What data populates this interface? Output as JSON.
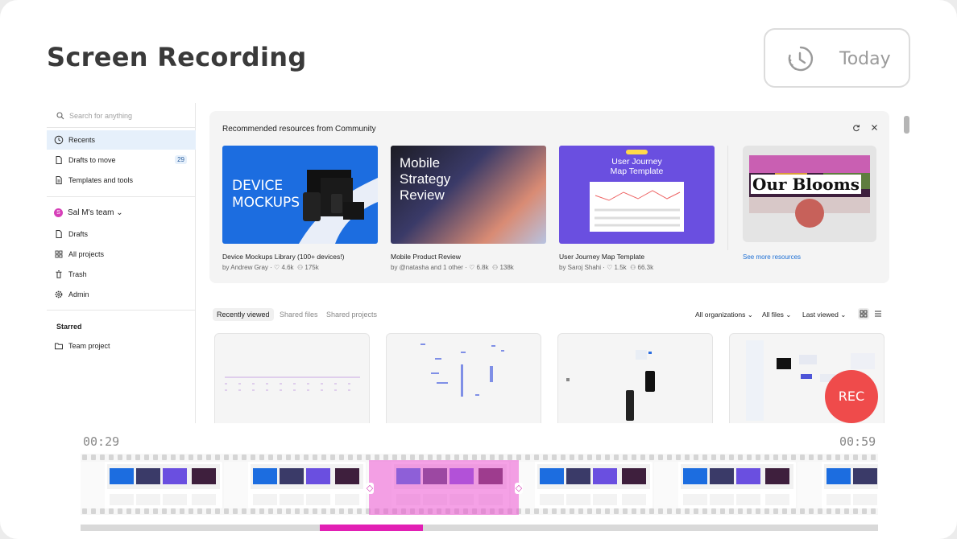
{
  "header": {
    "title": "Screen Recording",
    "today_label": "Today"
  },
  "app": {
    "search_placeholder": "Search for anything",
    "nav": [
      {
        "label": "Recents",
        "icon": "clock-icon",
        "active": true
      },
      {
        "label": "Drafts to move",
        "icon": "file-icon",
        "badge": "29"
      },
      {
        "label": "Templates and tools",
        "icon": "templates-icon"
      }
    ],
    "team": {
      "initial": "S",
      "name": "Sal M's team ⌄"
    },
    "team_nav": [
      {
        "label": "Drafts",
        "icon": "file-icon"
      },
      {
        "label": "All projects",
        "icon": "grid-icon"
      },
      {
        "label": "Trash",
        "icon": "trash-icon"
      },
      {
        "label": "Admin",
        "icon": "gear-icon"
      }
    ],
    "starred_label": "Starred",
    "starred_items": [
      {
        "label": "Team project",
        "icon": "folder-icon"
      }
    ],
    "community": {
      "title": "Recommended resources from Community",
      "resources": [
        {
          "name": "Device Mockups Library (100+ devices!)",
          "author": "by Andrew Gray",
          "likes": "4.6k",
          "users": "175k",
          "thumb_text": "DEVICE\nMOCKUPS"
        },
        {
          "name": "Mobile Product Review",
          "author": "by @natasha and 1 other",
          "likes": "6.8k",
          "users": "138k",
          "thumb_text": "Mobile\nStrategy\nReview"
        },
        {
          "name": "User Journey Map Template",
          "author": "by Saroj Shahi",
          "likes": "1.5k",
          "users": "66.3k",
          "thumb_text": "User Journey\nMap Template"
        }
      ],
      "fourth_thumb_text": "Our Blooms",
      "see_more": "See more resources"
    },
    "tabs": [
      "Recently viewed",
      "Shared files",
      "Shared projects"
    ],
    "filters": [
      "All organizations ⌄",
      "All files ⌄",
      "Last viewed ⌄"
    ]
  },
  "recording": {
    "rec_label": "REC",
    "start_time": "00:29",
    "end_time": "00:59",
    "scroll_position": 0.3,
    "selection_start": 0.36,
    "selection_end": 0.55
  },
  "colors": {
    "accent_pink": "#e21fb4",
    "rec_red": "#ef4b4b",
    "link_blue": "#1d6fd4"
  }
}
